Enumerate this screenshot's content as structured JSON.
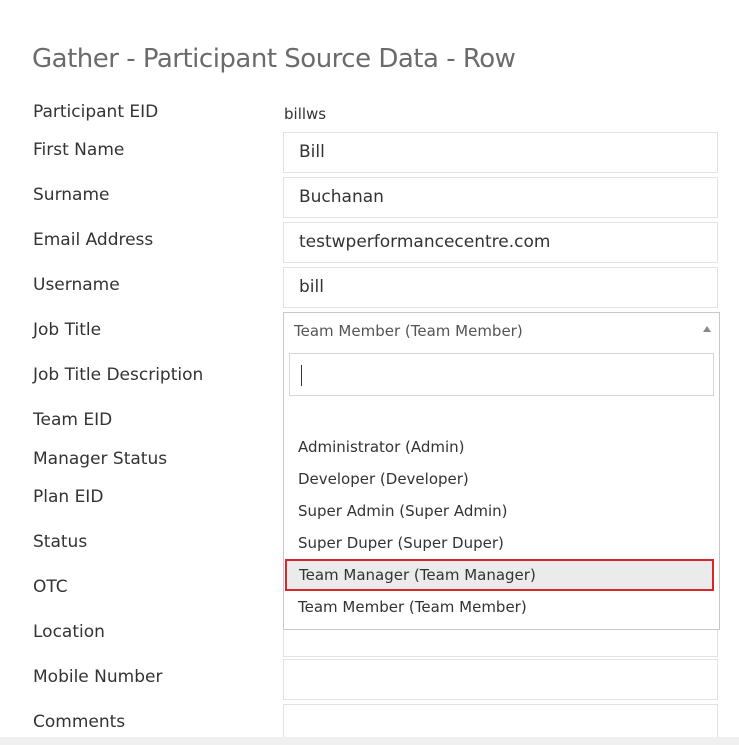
{
  "page_title": "Gather - Participant Source Data - Row",
  "fields": {
    "participant_eid": {
      "label": "Participant EID",
      "value": "billws"
    },
    "first_name": {
      "label": "First Name",
      "value": "Bill"
    },
    "surname": {
      "label": "Surname",
      "value": "Buchanan"
    },
    "email": {
      "label": "Email Address",
      "value": "testwperformancecentre.com"
    },
    "username": {
      "label": "Username",
      "value": "bill"
    },
    "job_title": {
      "label": "Job Title"
    },
    "job_title_description": {
      "label": "Job Title Description"
    },
    "team_eid": {
      "label": "Team EID"
    },
    "manager_status": {
      "label": "Manager Status"
    },
    "plan_eid": {
      "label": "Plan EID"
    },
    "status": {
      "label": "Status"
    },
    "otc": {
      "label": "OTC"
    },
    "location": {
      "label": "Location"
    },
    "mobile_number": {
      "label": "Mobile Number",
      "value": ""
    },
    "comments": {
      "label": "Comments",
      "value": ""
    }
  },
  "job_title_dropdown": {
    "selected": "Team Member (Team Member)",
    "search_value": "",
    "options": [
      "Administrator (Admin)",
      "Developer (Developer)",
      "Super Admin (Super Admin)",
      "Super Duper (Super Duper)",
      "Team Manager (Team Manager)",
      "Team Member (Team Member)"
    ],
    "highlighted_index": 4,
    "highlight_border_color": "#d9262c"
  }
}
